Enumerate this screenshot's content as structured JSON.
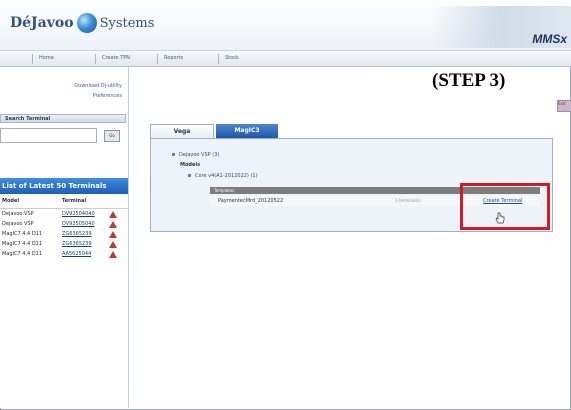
{
  "header": {
    "logo_left": "DéJavoo",
    "logo_right": "Systems",
    "brand": "MMSx"
  },
  "nav": {
    "items": [
      "Home",
      "Create TPN",
      "Reports",
      "Stock"
    ]
  },
  "overlay": {
    "step_label": "(STEP 3)",
    "side_cut_text": "Exit"
  },
  "sidebar": {
    "download_link": "Download Dj-utility",
    "preferences_link": "Preferences",
    "search_title": "Search Terminal",
    "search_button": "Go",
    "terminals_header": "List of Latest 50 Terminals",
    "table": {
      "columns": [
        "Model",
        "Terminal"
      ],
      "rows": [
        {
          "model": "Dejavoo VSP",
          "terminal": "DV92504040"
        },
        {
          "model": "Dejavoo VSP",
          "terminal": "DV92505040"
        },
        {
          "model": "MagIC7 4.4 D11",
          "terminal": "ZG6365239"
        },
        {
          "model": "MagIC7 4.4 D11",
          "terminal": "ZG6365239"
        },
        {
          "model": "MagIC7 4.4 D11",
          "terminal": "AA5625044"
        }
      ]
    }
  },
  "main": {
    "tabs": [
      {
        "label": "Vega"
      },
      {
        "label": "MagIC3"
      }
    ],
    "tree": {
      "device": "Dejavoo VSP (3)",
      "models_label": "Models",
      "branch": "Core v4(A1-2012022) (1)",
      "highlight_row": "Templates",
      "template": "PaymentecMrd_20120522",
      "template_meta": "1 terminal(s)",
      "create_link": "Create Terminal"
    }
  },
  "colors": {
    "highlight_box": "#d21b25",
    "tab_active": "#1f57a8"
  }
}
